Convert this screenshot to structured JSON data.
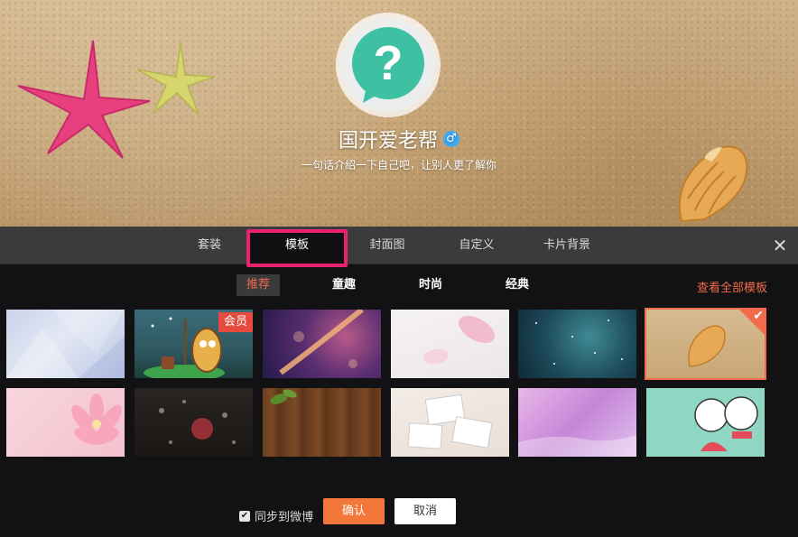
{
  "profile": {
    "name": "国开爱老帮",
    "gender_icon": "male-icon",
    "gender_symbol": "♂",
    "intro": "一句话介绍一下自己吧，让别人更了解你",
    "avatar_icon": "question-bubble-icon"
  },
  "tabs": [
    {
      "label": "套装"
    },
    {
      "label": "模板"
    },
    {
      "label": "封面图"
    },
    {
      "label": "自定义"
    },
    {
      "label": "卡片背景"
    }
  ],
  "close_symbol": "✕",
  "subcategories": [
    {
      "label": "推荐"
    },
    {
      "label": "童趣"
    },
    {
      "label": "时尚"
    },
    {
      "label": "经典"
    }
  ],
  "view_all_label": "查看全部模板",
  "member_badge": "会员",
  "selected_check": "✔",
  "footer": {
    "sync_label": "同步到微博",
    "sync_checked": true,
    "checkbox_mark": "✔",
    "confirm_label": "确认",
    "cancel_label": "取消"
  },
  "colors": {
    "accent_orange": "#f4773a",
    "link_red": "#f16b4b",
    "highlight_pink": "#e8226f"
  }
}
